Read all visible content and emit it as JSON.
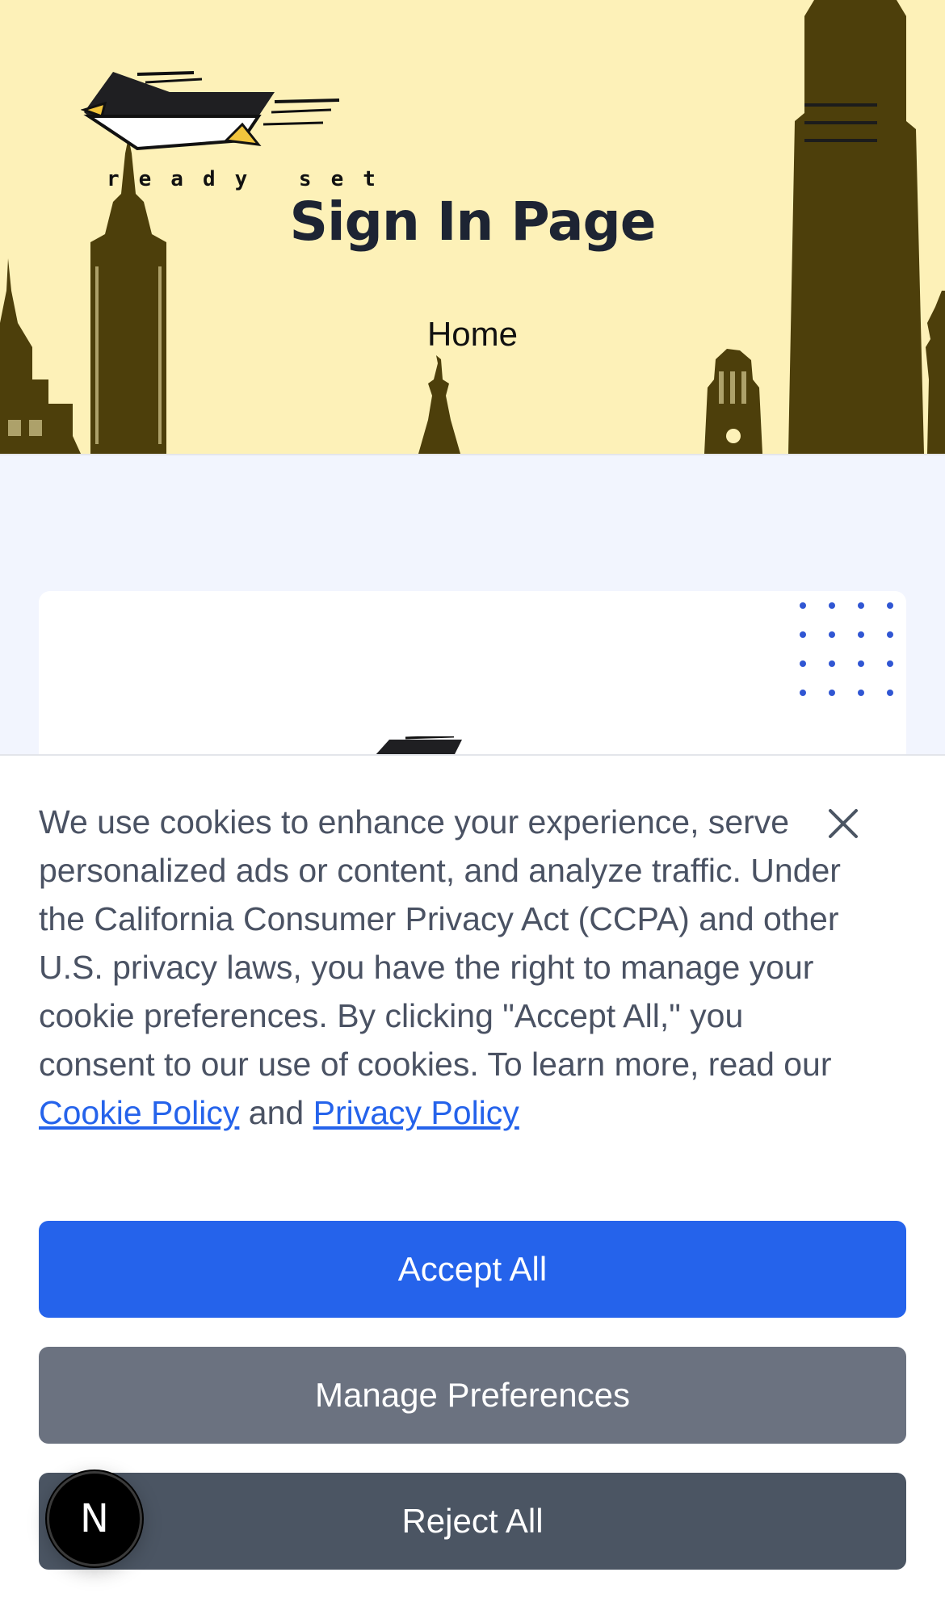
{
  "header": {
    "logo_text": "ready set",
    "page_title": "Sign In Page",
    "breadcrumb": "Home"
  },
  "cookie_banner": {
    "message": "We use cookies to enhance your experience, serve personalized ads or content, and analyze traffic. Under the California Consumer Privacy Act (CCPA) and other U.S. privacy laws, you have the right to manage your cookie preferences. By clicking \"Accept All,\" you consent to our use of cookies. To learn more, read our",
    "cookie_policy_link": "Cookie Policy",
    "and_text": "and",
    "privacy_policy_link": "Privacy Policy",
    "accept_label": "Accept All",
    "manage_label": "Manage Preferences",
    "reject_label": "Reject All"
  },
  "dev_badge": {
    "label": "N"
  },
  "colors": {
    "hero_bg": "#fdf1b8",
    "skyline": "#4d3f0b",
    "accent": "#2563eb",
    "manage_button": "#6b7280",
    "reject_button": "#4b5563",
    "page_bg": "#f2f5fe"
  }
}
